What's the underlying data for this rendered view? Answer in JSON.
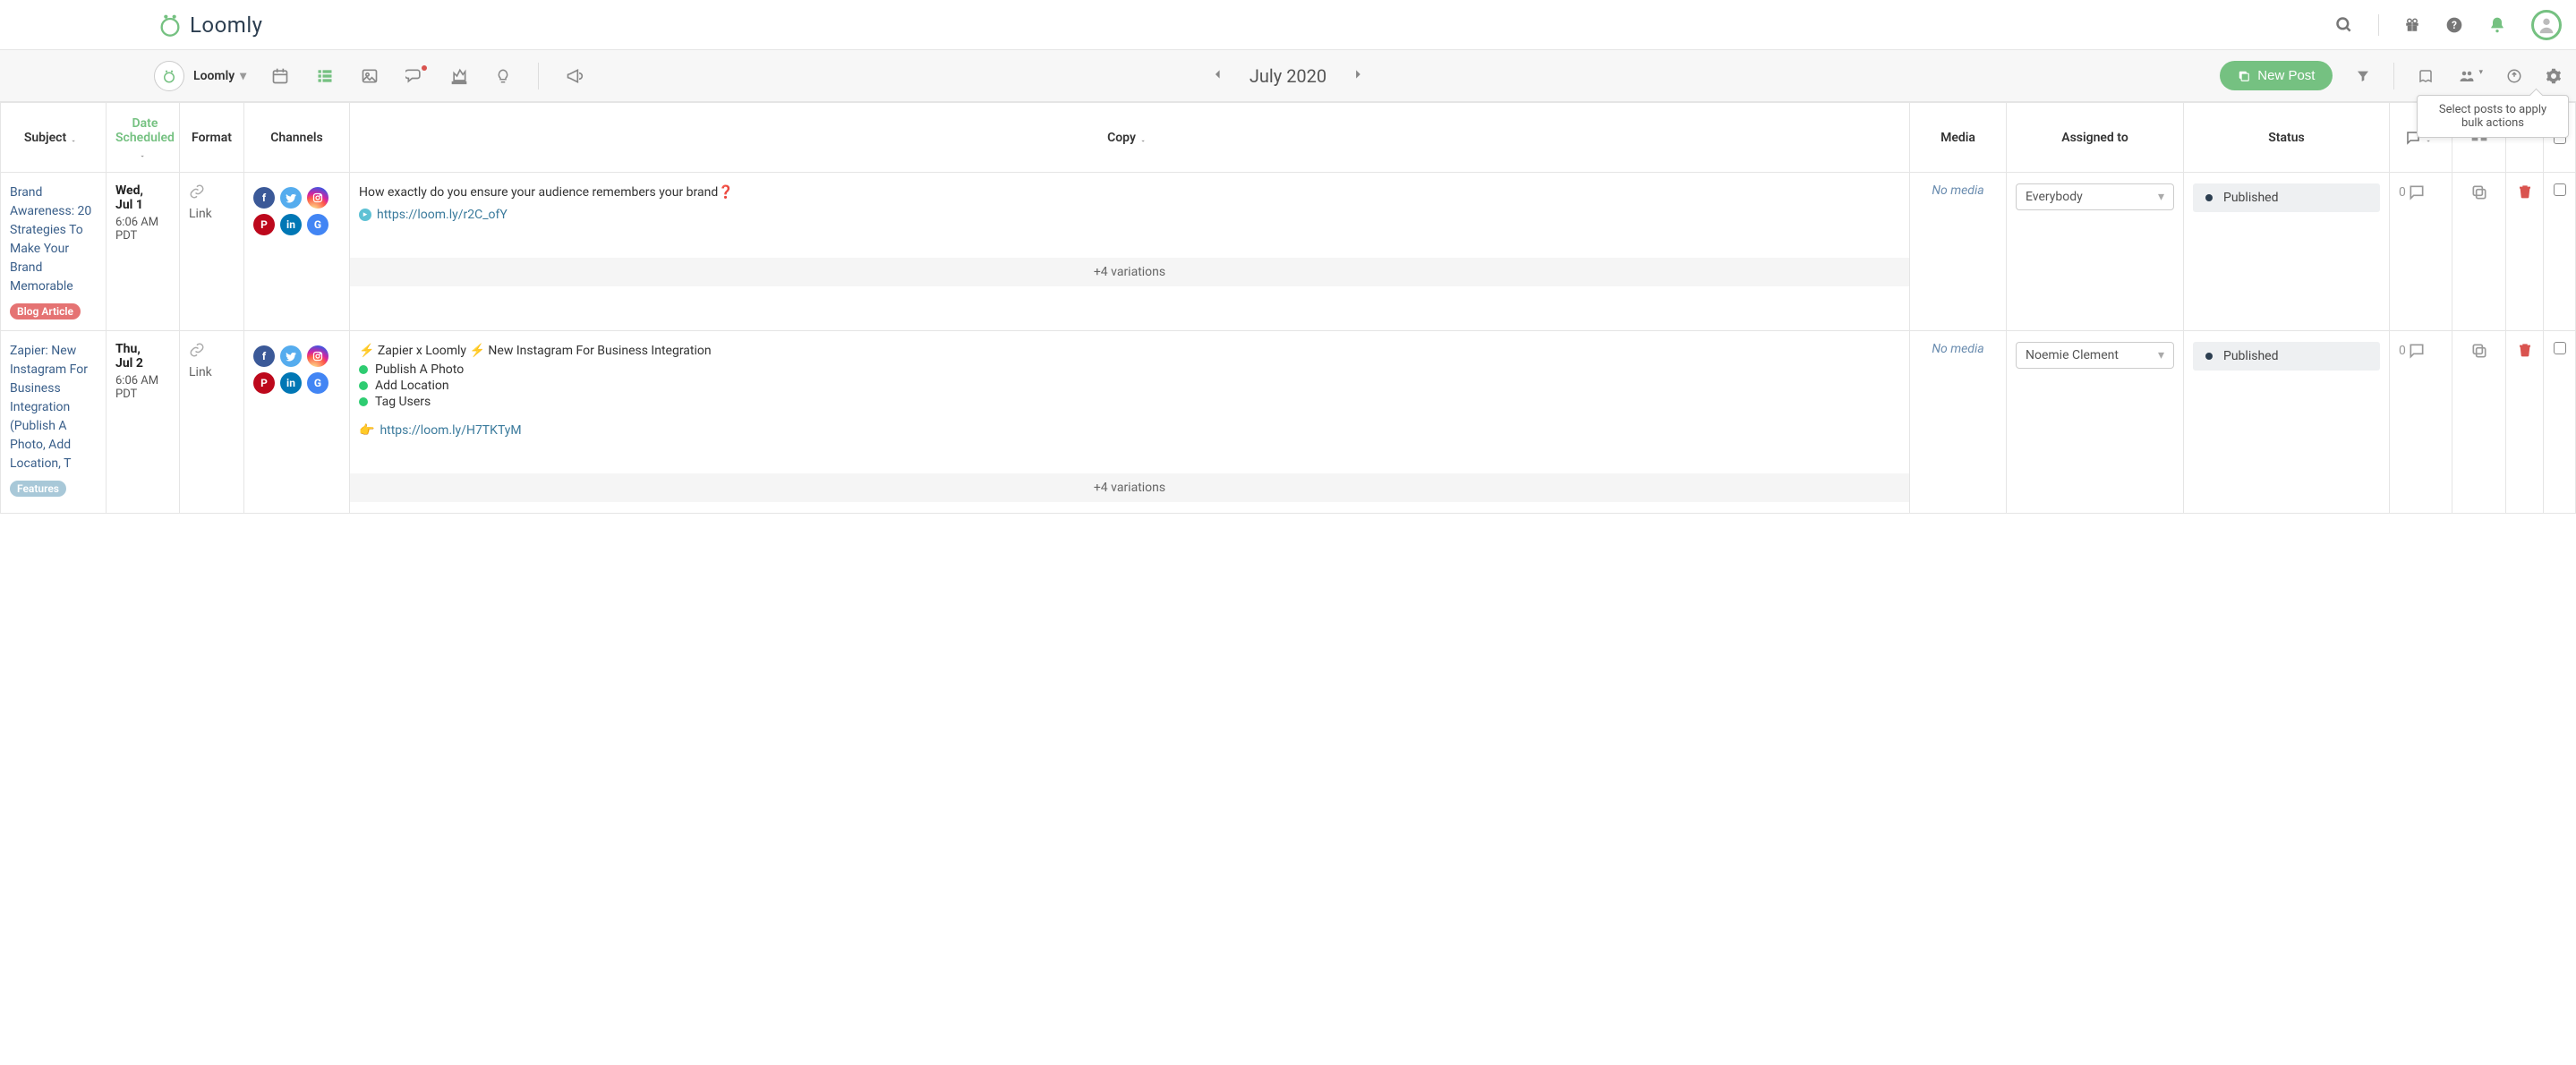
{
  "brand": {
    "name": "Loomly"
  },
  "calendar_selector": {
    "label": "Loomly"
  },
  "month_nav": {
    "label": "July 2020"
  },
  "new_post_button": "New Post",
  "tooltip": "Select posts to apply bulk actions",
  "columns": {
    "subject": "Subject",
    "date": "Date Scheduled",
    "format": "Format",
    "channels": "Channels",
    "copy": "Copy",
    "media": "Media",
    "assigned": "Assigned to",
    "status": "Status"
  },
  "rows": [
    {
      "subject": "Brand Awareness: 20 Strategies To Make Your Brand Memorable",
      "tag": {
        "label": "Blog Article",
        "class": "blog"
      },
      "date": {
        "dow": "Wed,",
        "md": "Jul 1",
        "time": "6:06 AM PDT"
      },
      "format": "Link",
      "copy_text": "How exactly do you ensure your audience remembers your brand❓",
      "copy_link": "https://loom.ly/r2C_ofY",
      "variations": "+4 variations",
      "media": "No media",
      "assigned": "Everybody",
      "status": "Published",
      "comments": "0"
    },
    {
      "subject": "Zapier: New Instagram For Business Integration (Publish A Photo, Add Location, T",
      "tag": {
        "label": "Features",
        "class": "features"
      },
      "date": {
        "dow": "Thu,",
        "md": "Jul 2",
        "time": "6:06 AM PDT"
      },
      "format": "Link",
      "copy_text": "⚡ Zapier x Loomly ⚡ New Instagram For Business Integration",
      "bullets": [
        "Publish A Photo",
        "Add Location",
        "Tag Users"
      ],
      "copy_link_prefix": "👉 ",
      "copy_link": "https://loom.ly/H7TKTyM",
      "variations": "+4 variations",
      "media": "No media",
      "assigned": "Noemie Clement",
      "status": "Published",
      "comments": "0"
    }
  ]
}
